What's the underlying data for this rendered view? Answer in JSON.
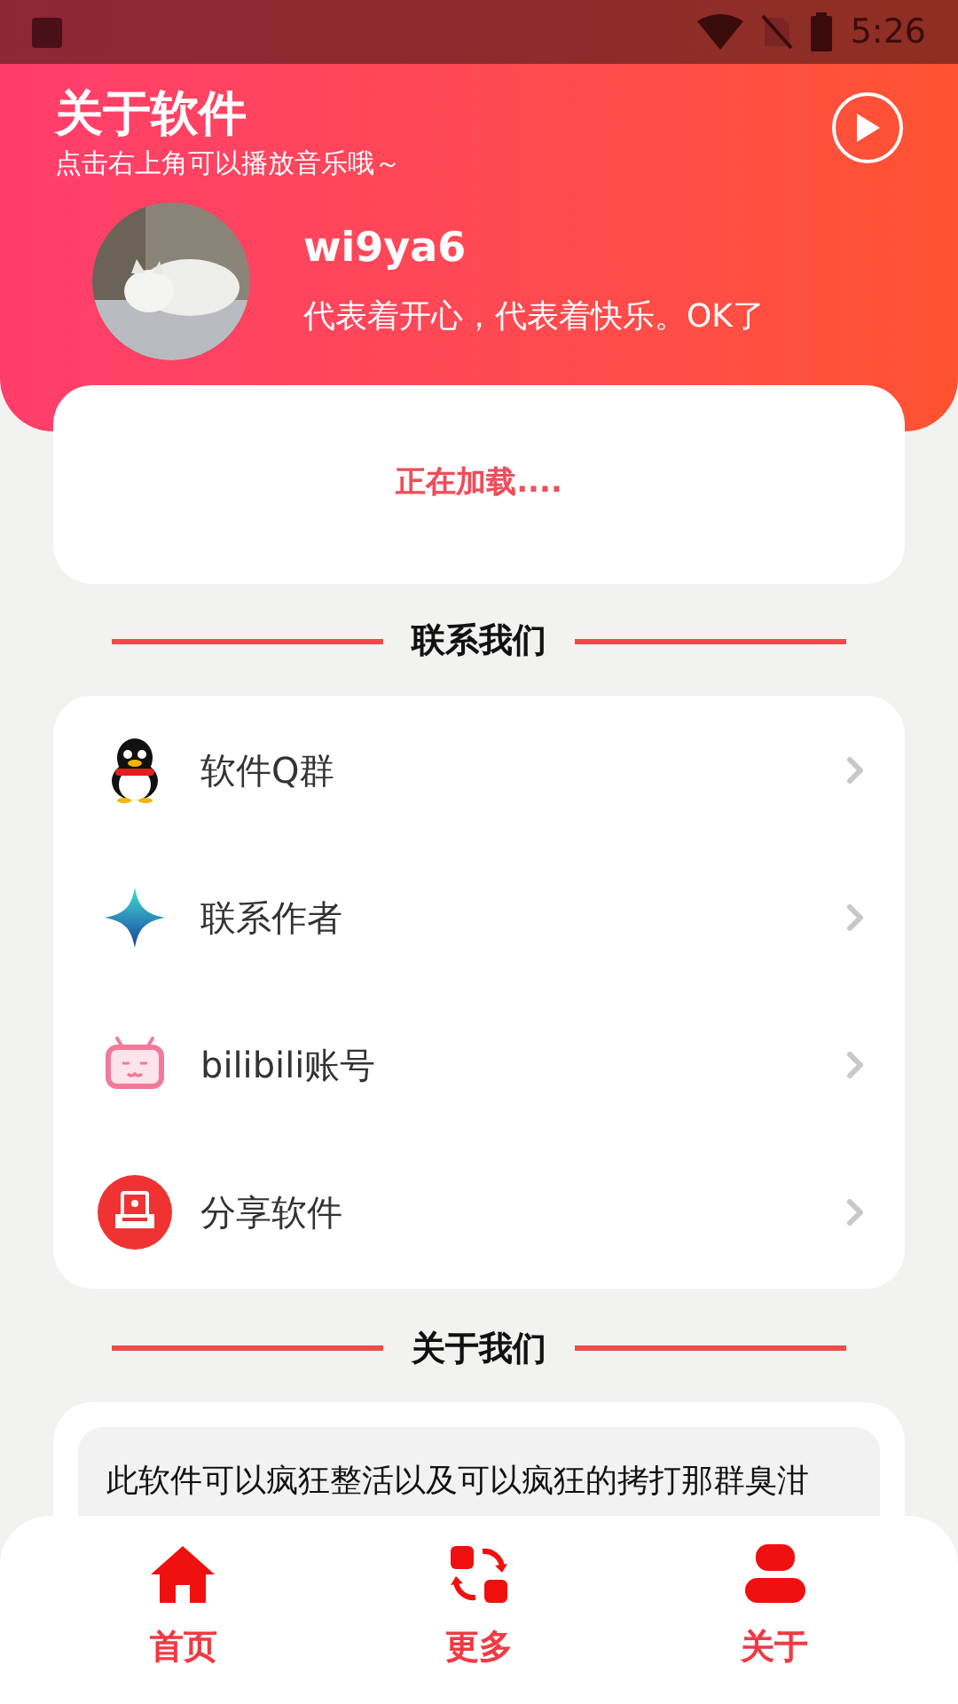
{
  "status_bar": {
    "time": "5:26"
  },
  "header": {
    "title": "关于软件",
    "subtitle": "点击右上角可以播放音乐哦～",
    "profile": {
      "name": "wi9ya6",
      "motto": "代表着开心，代表着快乐。OK了"
    }
  },
  "loading_card": {
    "text": "正在加载...."
  },
  "contact_section": {
    "title": "联系我们",
    "items": [
      {
        "label": "软件Q群"
      },
      {
        "label": "联系作者"
      },
      {
        "label": "bilibili账号"
      },
      {
        "label": "分享软件"
      }
    ]
  },
  "about_section": {
    "title": "关于我们",
    "text": "此软件可以疯狂整活以及可以疯狂的拷打那群臭泔"
  },
  "bottom_nav": [
    {
      "label": "首页"
    },
    {
      "label": "更多"
    },
    {
      "label": "关于"
    }
  ]
}
